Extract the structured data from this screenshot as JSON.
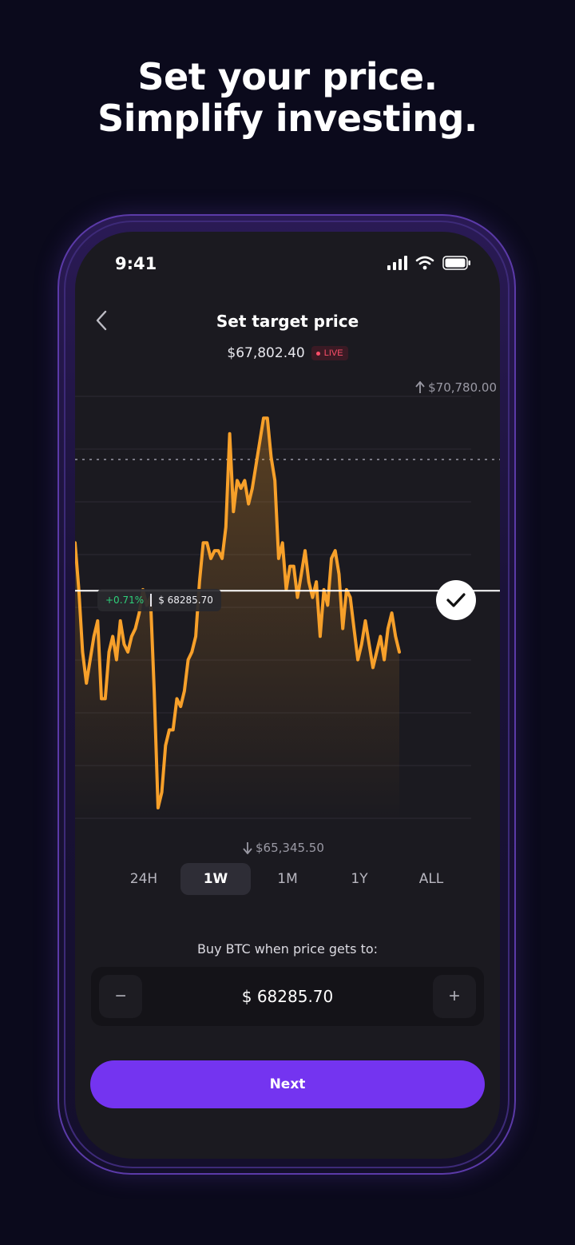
{
  "promo": {
    "headline_line1": "Set your price.",
    "headline_line2": "Simplify investing."
  },
  "status_bar": {
    "time": "9:41"
  },
  "header": {
    "title": "Set target price",
    "current_price": "$67,802.40",
    "live_label": "LIVE"
  },
  "chart": {
    "max_label": "$70,780.00",
    "min_label": "$65,345.50",
    "target_change": "+0.71%",
    "target_value": "$ 68285.70"
  },
  "chart_data": {
    "type": "line",
    "ylim": [
      65345.5,
      70780.0
    ],
    "target": 68285.7,
    "series": [
      {
        "values": [
          68900,
          68300,
          67500,
          67100,
          67400,
          67700,
          67900,
          66900,
          66900,
          67500,
          67700,
          67400,
          67900,
          67600,
          67500,
          67700,
          67800,
          68000,
          68300,
          68100,
          68200,
          67000,
          65500,
          65700,
          66300,
          66500,
          66500,
          66900,
          66800,
          67000,
          67400,
          67500,
          67700,
          68400,
          68900,
          68900,
          68700,
          68800,
          68800,
          68700,
          69100,
          70300,
          69300,
          69700,
          69600,
          69700,
          69400,
          69600,
          69900,
          70200,
          70500,
          70500,
          70000,
          69700,
          68700,
          68900,
          68300,
          68600,
          68600,
          68200,
          68500,
          68800,
          68400,
          68200,
          68400,
          67700,
          68300,
          68100,
          68700,
          68800,
          68500,
          67800,
          68300,
          68200,
          67800,
          67400,
          67600,
          67900,
          67600,
          67300,
          67500,
          67700,
          67400,
          67800,
          68000,
          67700,
          67500
        ]
      }
    ]
  },
  "range_tabs": [
    {
      "label": "24H",
      "active": false
    },
    {
      "label": "1W",
      "active": true
    },
    {
      "label": "1M",
      "active": false
    },
    {
      "label": "1Y",
      "active": false
    },
    {
      "label": "ALL",
      "active": false
    }
  ],
  "order": {
    "prompt": "Buy BTC when price gets to:",
    "value": "$ 68285.70",
    "minus_symbol": "−",
    "plus_symbol": "+"
  },
  "cta": {
    "label": "Next"
  },
  "colors": {
    "background": "#0b0a1c",
    "line": "#f7a02a",
    "accent": "#7434f0",
    "positive": "#2ed07a",
    "live": "#ff4f6a"
  }
}
